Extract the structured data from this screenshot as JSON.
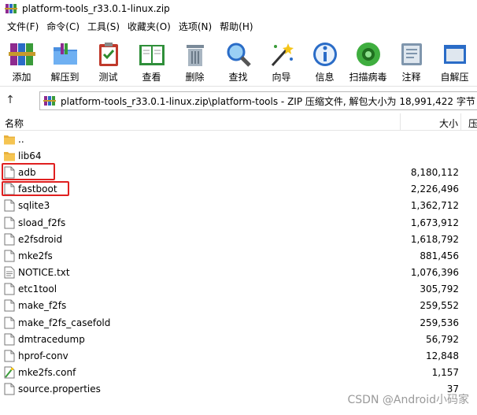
{
  "window": {
    "title": "platform-tools_r33.0.1-linux.zip"
  },
  "menu": [
    {
      "label": "文件(F)",
      "key": "file"
    },
    {
      "label": "命令(C)",
      "key": "commands"
    },
    {
      "label": "工具(S)",
      "key": "tools"
    },
    {
      "label": "收藏夹(O)",
      "key": "favorites"
    },
    {
      "label": "选项(N)",
      "key": "options"
    },
    {
      "label": "帮助(H)",
      "key": "help"
    }
  ],
  "toolbar": [
    {
      "label": "添加",
      "icon": "books-add-icon"
    },
    {
      "label": "解压到",
      "icon": "folder-extract-icon"
    },
    {
      "label": "测试",
      "icon": "clipboard-test-icon"
    },
    {
      "label": "查看",
      "icon": "book-view-icon"
    },
    {
      "label": "删除",
      "icon": "trash-icon"
    },
    {
      "label": "查找",
      "icon": "magnifier-icon"
    },
    {
      "label": "向导",
      "icon": "wand-icon"
    },
    {
      "label": "信息",
      "icon": "info-icon"
    },
    {
      "label": "扫描病毒",
      "icon": "virus-scan-icon"
    },
    {
      "label": "注释",
      "icon": "comment-icon"
    },
    {
      "label": "自解压",
      "icon": "sfx-icon"
    }
  ],
  "address": {
    "path": "platform-tools_r33.0.1-linux.zip\\platform-tools - ZIP 压缩文件, 解包大小为 18,991,422 字节"
  },
  "columns": {
    "name": "名称",
    "size": "大小",
    "next": "压"
  },
  "files": [
    {
      "name": "..",
      "size": "",
      "type": "folder"
    },
    {
      "name": "lib64",
      "size": "",
      "type": "folder"
    },
    {
      "name": "adb",
      "size": "8,180,112",
      "type": "file"
    },
    {
      "name": "fastboot",
      "size": "2,226,496",
      "type": "file"
    },
    {
      "name": "sqlite3",
      "size": "1,362,712",
      "type": "file"
    },
    {
      "name": "sload_f2fs",
      "size": "1,673,912",
      "type": "file"
    },
    {
      "name": "e2fsdroid",
      "size": "1,618,792",
      "type": "file"
    },
    {
      "name": "mke2fs",
      "size": "881,456",
      "type": "file"
    },
    {
      "name": "NOTICE.txt",
      "size": "1,076,396",
      "type": "text"
    },
    {
      "name": "etc1tool",
      "size": "305,792",
      "type": "file"
    },
    {
      "name": "make_f2fs",
      "size": "259,552",
      "type": "file"
    },
    {
      "name": "make_f2fs_casefold",
      "size": "259,536",
      "type": "file"
    },
    {
      "name": "dmtracedump",
      "size": "56,792",
      "type": "file"
    },
    {
      "name": "hprof-conv",
      "size": "12,848",
      "type": "file"
    },
    {
      "name": "mke2fs.conf",
      "size": "1,157",
      "type": "conf"
    },
    {
      "name": "source.properties",
      "size": "37",
      "type": "file"
    }
  ],
  "watermark": "CSDN @Android小码家",
  "colors": {
    "highlight": "#e02020",
    "folder": "#f5c451"
  }
}
